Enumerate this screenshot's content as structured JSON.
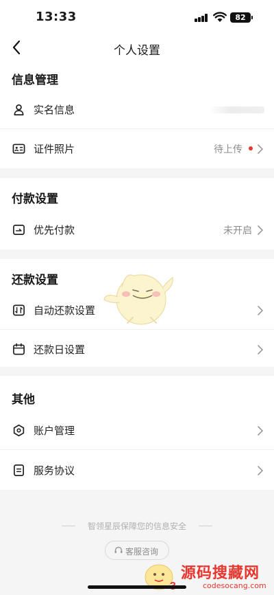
{
  "status_bar": {
    "time": "13:33",
    "battery": "82"
  },
  "nav": {
    "title": "个人设置"
  },
  "sections": [
    {
      "title": "信息管理",
      "rows": [
        {
          "label": "实名信息",
          "value": "",
          "icon": "user-icon"
        },
        {
          "label": "证件照片",
          "value": "待上传",
          "icon": "id-card-icon",
          "dot": true
        }
      ]
    },
    {
      "title": "付款设置",
      "rows": [
        {
          "label": "优先付款",
          "value": "未开启",
          "icon": "priority-payment-icon"
        }
      ]
    },
    {
      "title": "还款设置",
      "rows": [
        {
          "label": "自动还款设置",
          "value": "",
          "icon": "auto-repay-icon"
        },
        {
          "label": "还款日设置",
          "value": "",
          "icon": "calendar-icon"
        }
      ]
    },
    {
      "title": "其他",
      "rows": [
        {
          "label": "账户管理",
          "value": "",
          "icon": "account-icon"
        },
        {
          "label": "服务协议",
          "value": "",
          "icon": "document-icon"
        }
      ]
    }
  ],
  "footer": {
    "security_text": "智领星辰保障您的信息安全",
    "service_button": "客服咨询"
  },
  "watermark": {
    "text_cn": "源码搜藏网",
    "text_en": "codesocang.com"
  },
  "colors": {
    "accent": "#e8362f",
    "muted": "#8c8c8c",
    "background": "#f5f5f5"
  }
}
